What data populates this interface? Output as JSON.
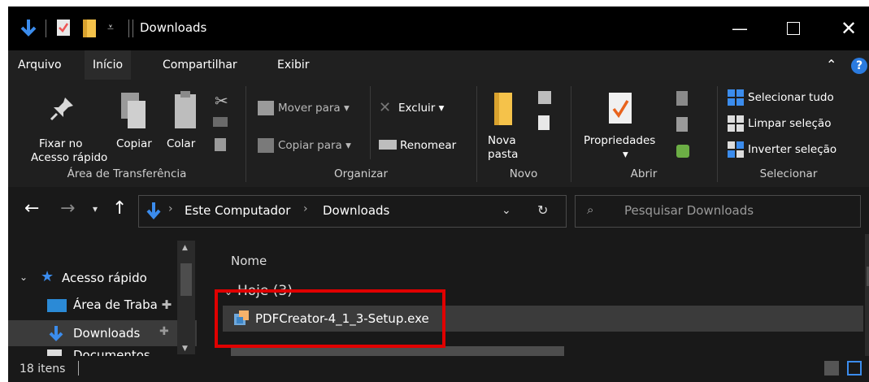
{
  "titlebar": {
    "title": "Downloads",
    "controls": [
      "minimize-icon",
      "maximize-icon",
      "close-icon"
    ]
  },
  "menubar": {
    "tabs": [
      "Arquivo",
      "Início",
      "Compartilhar",
      "Exibir"
    ],
    "help": "?"
  },
  "ribbon": {
    "clipboard": {
      "pin": "Fixar no",
      "pin2": "Acesso rápido",
      "copy": "Copiar",
      "paste": "Colar",
      "group": "Área de Transferência"
    },
    "organize": {
      "move": "Mover para",
      "copyto": "Copiar para",
      "delete": "Excluir",
      "rename": "Renomear",
      "group": "Organizar"
    },
    "new": {
      "folder": "Nova",
      "folder2": "pasta",
      "group": "Novo"
    },
    "open": {
      "props": "Propriedades",
      "group": "Abrir"
    },
    "select": {
      "all": "Selecionar tudo",
      "none": "Limpar seleção",
      "invert": "Inverter seleção",
      "group": "Selecionar"
    }
  },
  "address": {
    "path": [
      "Este Computador",
      "Downloads"
    ],
    "search_placeholder": "Pesquisar Downloads"
  },
  "nav": {
    "quick_access": "Acesso rápido",
    "items": [
      "Área de Traba",
      "Downloads",
      "Documentos"
    ]
  },
  "content": {
    "column": "Nome",
    "group": "Hoje (3)",
    "files": [
      "PDFCreator-4_1_3-Setup.exe"
    ]
  },
  "status": {
    "count": "18 itens"
  },
  "colors": {
    "accent": "#3b8ced",
    "folder": "#f5c24a",
    "highlight": "#e00000"
  }
}
